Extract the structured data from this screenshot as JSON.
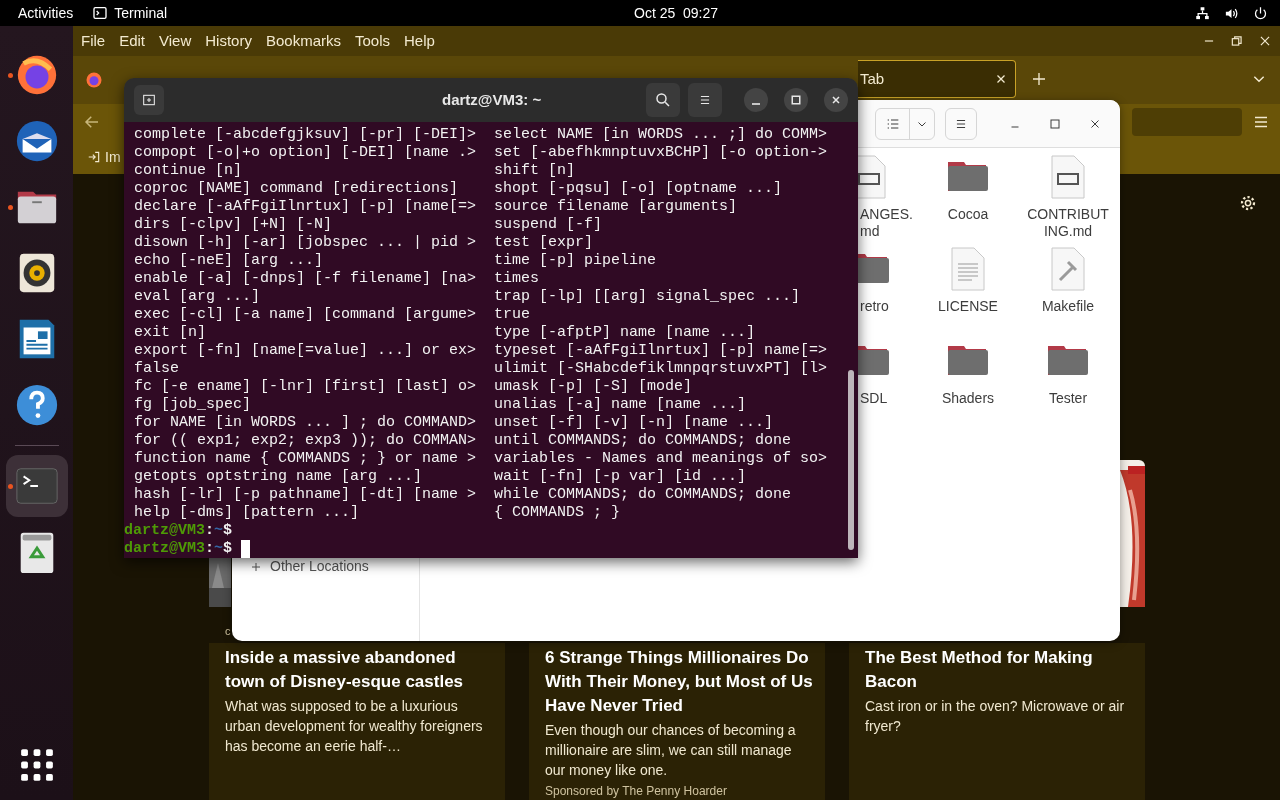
{
  "top_bar": {
    "activities": "Activities",
    "app": "Terminal",
    "clock": "Oct 25  09:27"
  },
  "dock": {
    "items": [
      {
        "kind": "firefox",
        "running": true,
        "selected": false
      },
      {
        "kind": "thunderbird",
        "running": false,
        "selected": false
      },
      {
        "kind": "files",
        "running": true,
        "selected": false
      },
      {
        "kind": "rhythmbox",
        "running": false,
        "selected": false
      },
      {
        "kind": "writer",
        "running": false,
        "selected": false
      },
      {
        "kind": "help",
        "running": false,
        "selected": false
      },
      {
        "kind": "terminal",
        "running": true,
        "selected": true
      },
      {
        "kind": "trash",
        "running": false,
        "selected": false
      }
    ]
  },
  "browser": {
    "menu": [
      "File",
      "Edit",
      "View",
      "History",
      "Bookmarks",
      "Tools",
      "Help"
    ],
    "tab": {
      "label": "Tab"
    },
    "bookmark": "Im",
    "cards": [
      {
        "category": "c",
        "title": "Inside a massive abandoned town of Disney-esque castles",
        "summary": "What was supposed to be a luxurious urban development for wealthy foreigners has become an eerie half-…"
      },
      {
        "title": "6 Strange Things Millionaires Do With Their Money, but Most of Us Have Never Tried",
        "summary": "Even though our chances of becoming a millionaire are slim, we can still manage our money like one.",
        "sponsor": "Sponsored by The Penny Hoarder"
      },
      {
        "title": "The Best Method for Making Bacon",
        "summary": "Cast iron or in the oven? Microwave or air fryer?"
      }
    ]
  },
  "files": {
    "sidebar": [
      "Other Locations"
    ],
    "items": [
      {
        "kind": "markdown",
        "name": "ANGES.\nmd"
      },
      {
        "kind": "folder",
        "name": "Cocoa"
      },
      {
        "kind": "markdown",
        "name": "CONTRIBUT\nING.md"
      },
      {
        "kind": "folder",
        "name": "retro"
      },
      {
        "kind": "text",
        "name": "LICENSE"
      },
      {
        "kind": "makefile",
        "name": "Makefile"
      },
      {
        "kind": "folder",
        "name": "SDL"
      },
      {
        "kind": "folder",
        "name": "Shaders"
      },
      {
        "kind": "folder",
        "name": "Tester"
      }
    ]
  },
  "terminal": {
    "title": "dartz@VM3: ~",
    "lines": [
      {
        "left": "complete [-abcdefgjksuv] [-pr] [-DEI]>",
        "right": "select NAME [in WORDS ... ;] do COMM>"
      },
      {
        "left": "compopt [-o|+o option] [-DEI] [name .>",
        "right": "set [-abefhkmnptuvxBCHP] [-o option->"
      },
      {
        "left": "continue [n]",
        "right": "shift [n]"
      },
      {
        "left": "coproc [NAME] command [redirections]",
        "right": "shopt [-pqsu] [-o] [optname ...]"
      },
      {
        "left": "declare [-aAfFgiIlnrtux] [-p] [name[=>",
        "right": "source filename [arguments]"
      },
      {
        "left": "dirs [-clpv] [+N] [-N]",
        "right": "suspend [-f]"
      },
      {
        "left": "disown [-h] [-ar] [jobspec ... | pid >",
        "right": "test [expr]"
      },
      {
        "left": "echo [-neE] [arg ...]",
        "right": "time [-p] pipeline"
      },
      {
        "left": "enable [-a] [-dnps] [-f filename] [na>",
        "right": "times"
      },
      {
        "left": "eval [arg ...]",
        "right": "trap [-lp] [[arg] signal_spec ...]"
      },
      {
        "left": "exec [-cl] [-a name] [command [argume>",
        "right": "true"
      },
      {
        "left": "exit [n]",
        "right": "type [-afptP] name [name ...]"
      },
      {
        "left": "export [-fn] [name[=value] ...] or ex>",
        "right": "typeset [-aAfFgiIlnrtux] [-p] name[=>"
      },
      {
        "left": "false",
        "right": "ulimit [-SHabcdefiklmnpqrstuvxPT] [l>"
      },
      {
        "left": "fc [-e ename] [-lnr] [first] [last] o>",
        "right": "umask [-p] [-S] [mode]"
      },
      {
        "left": "fg [job_spec]",
        "right": "unalias [-a] name [name ...]"
      },
      {
        "left": "for NAME [in WORDS ... ] ; do COMMAND>",
        "right": "unset [-f] [-v] [-n] [name ...]"
      },
      {
        "left": "for (( exp1; exp2; exp3 )); do COMMAN>",
        "right": "until COMMANDS; do COMMANDS; done"
      },
      {
        "left": "function name { COMMANDS ; } or name >",
        "right": "variables - Names and meanings of so>"
      },
      {
        "left": "getopts optstring name [arg ...]",
        "right": "wait [-fn] [-p var] [id ...]"
      },
      {
        "left": "hash [-lr] [-p pathname] [-dt] [name >",
        "right": "while COMMANDS; do COMMANDS; done"
      },
      {
        "left": "help [-dms] [pattern ...]",
        "right": "{ COMMANDS ; }"
      }
    ],
    "prompts": [
      {
        "user": "dartz@VM3",
        "sep": ":",
        "path": "~",
        "symbol": "$",
        "cursor": false
      },
      {
        "user": "dartz@VM3",
        "sep": ":",
        "path": "~",
        "symbol": "$",
        "cursor": true
      }
    ]
  }
}
